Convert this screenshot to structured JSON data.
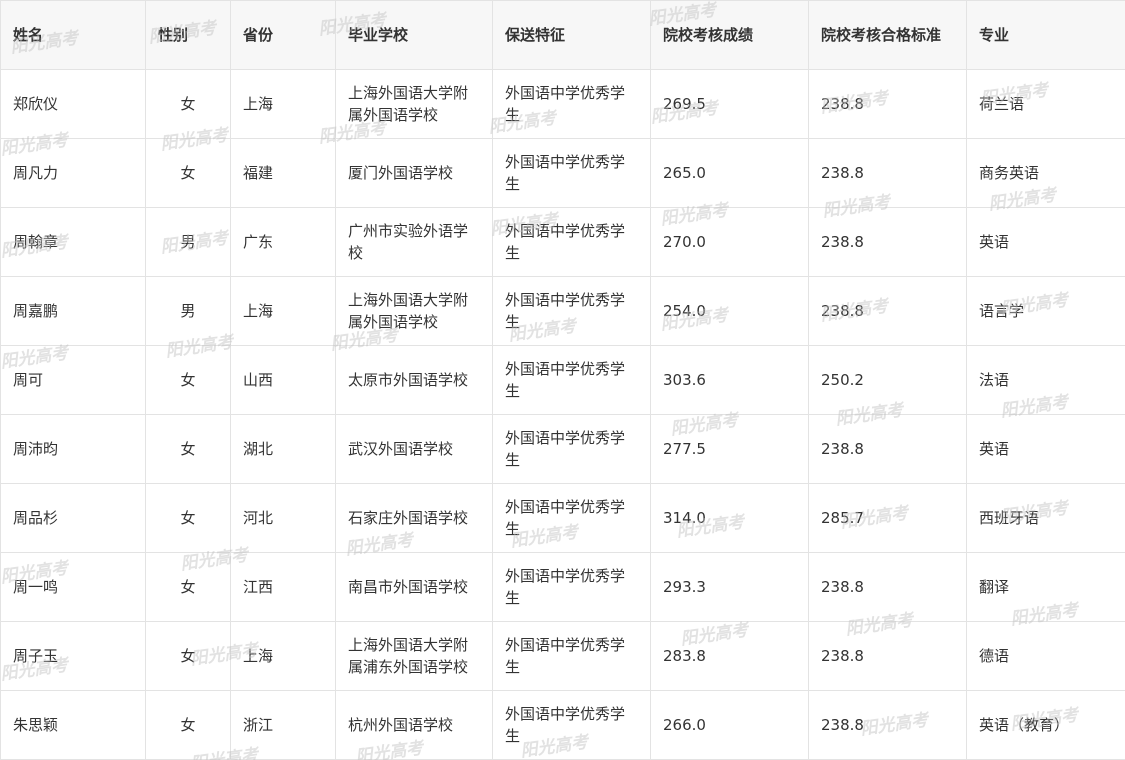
{
  "table": {
    "headers": [
      "姓名",
      "性别",
      "省份",
      "毕业学校",
      "保送特征",
      "院校考核成绩",
      "院校考核合格标准",
      "专业"
    ],
    "rows": [
      [
        "郑欣仪",
        "女",
        "上海",
        "上海外国语大学附属外国语学校",
        "外国语中学优秀学生",
        "269.5",
        "238.8",
        "荷兰语"
      ],
      [
        "周凡力",
        "女",
        "福建",
        "厦门外国语学校",
        "外国语中学优秀学生",
        "265.0",
        "238.8",
        "商务英语"
      ],
      [
        "周翰章",
        "男",
        "广东",
        "广州市实验外语学校",
        "外国语中学优秀学生",
        "270.0",
        "238.8",
        "英语"
      ],
      [
        "周嘉鹏",
        "男",
        "上海",
        "上海外国语大学附属外国语学校",
        "外国语中学优秀学生",
        "254.0",
        "238.8",
        "语言学"
      ],
      [
        "周可",
        "女",
        "山西",
        "太原市外国语学校",
        "外国语中学优秀学生",
        "303.6",
        "250.2",
        "法语"
      ],
      [
        "周沛昀",
        "女",
        "湖北",
        "武汉外国语学校",
        "外国语中学优秀学生",
        "277.5",
        "238.8",
        "英语"
      ],
      [
        "周品杉",
        "女",
        "河北",
        "石家庄外国语学校",
        "外国语中学优秀学生",
        "314.0",
        "285.7",
        "西班牙语"
      ],
      [
        "周一鸣",
        "女",
        "江西",
        "南昌市外国语学校",
        "外国语中学优秀学生",
        "293.3",
        "238.8",
        "翻译"
      ],
      [
        "周子玉",
        "女",
        "上海",
        "上海外国语大学附属浦东外国语学校",
        "外国语中学优秀学生",
        "283.8",
        "238.8",
        "德语"
      ],
      [
        "朱思颖",
        "女",
        "浙江",
        "杭州外国语学校",
        "外国语中学优秀学生",
        "266.0",
        "238.8",
        "英语（教育）"
      ]
    ]
  },
  "watermark": {
    "text": "阳光高考"
  }
}
